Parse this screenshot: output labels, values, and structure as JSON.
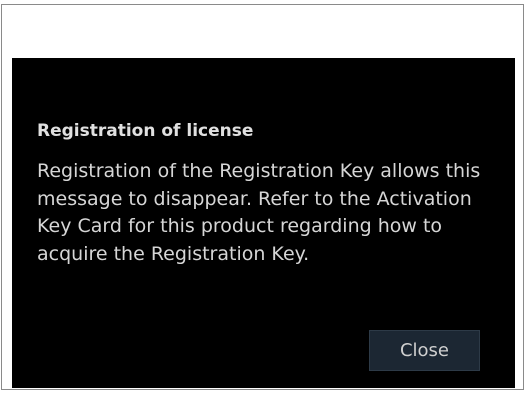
{
  "dialog": {
    "title": "Registration of license",
    "message": "Registration of the Registration Key allows this message to disappear. Refer to the Activation Key Card for this product regarding how to acquire the Registration Key.",
    "close_label": "Close"
  },
  "colors": {
    "dialog_background": "#000000",
    "button_background": "#1c2733",
    "text": "#d6d6d6"
  }
}
